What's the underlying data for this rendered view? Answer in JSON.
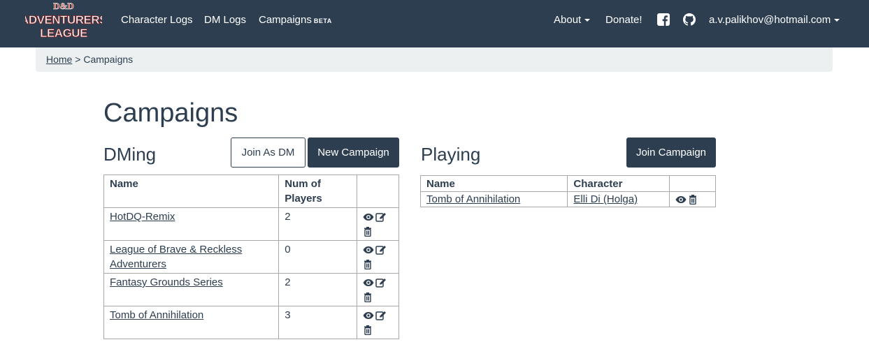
{
  "navbar": {
    "logo_text": "ADVENTURERS LEAGUE",
    "logo_badge": "D&D",
    "links": {
      "character_logs": "Character Logs",
      "dm_logs": "DM Logs",
      "campaigns": "Campaigns",
      "campaigns_badge": "BETA",
      "about": "About",
      "donate": "Donate!",
      "user": "a.v.palikhov@hotmail.com"
    }
  },
  "breadcrumb": {
    "home": "Home",
    "separator": ">",
    "current": "Campaigns"
  },
  "page": {
    "title": "Campaigns"
  },
  "dming": {
    "title": "DMing",
    "join_button": "Join As DM",
    "new_button": "New Campaign",
    "columns": {
      "name": "Name",
      "players_line1": "Num of",
      "players_line2": "Players"
    },
    "rows": [
      {
        "name": "HotDQ-Remix",
        "players": "2"
      },
      {
        "name": "League of Brave & Reckless Adventurers",
        "players": "0"
      },
      {
        "name": "Fantasy Grounds Series",
        "players": "2"
      },
      {
        "name": "Tomb of Annihilation",
        "players": "3"
      }
    ]
  },
  "playing": {
    "title": "Playing",
    "join_button": "Join Campaign",
    "columns": {
      "name": "Name",
      "character": "Character"
    },
    "rows": [
      {
        "name": "Tomb of Annihilation",
        "character": "Elli Di (Holga)"
      }
    ]
  },
  "icons": {
    "view": "eye-icon",
    "edit": "edit-icon",
    "delete": "trash-icon",
    "facebook": "facebook-icon",
    "github": "github-icon"
  },
  "colors": {
    "navbar_bg": "#2c3e50",
    "breadcrumb_bg": "#ecf0f1",
    "logo_red": "#c0392b",
    "text": "#2c3e50"
  }
}
